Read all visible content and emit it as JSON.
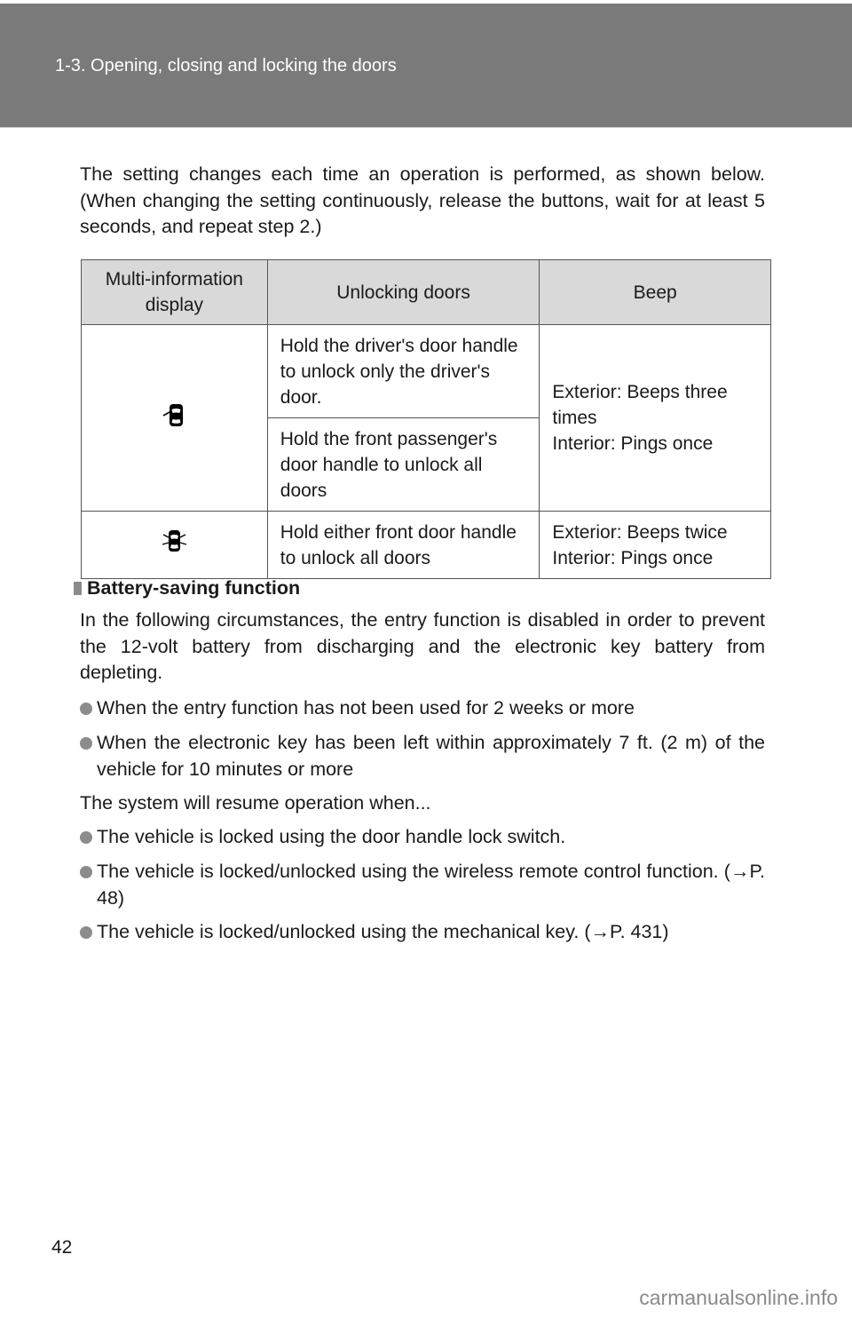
{
  "header": {
    "section_title": "1-3. Opening, closing and locking the doors"
  },
  "intro_text": "The setting changes each time an operation is performed, as shown below. (When changing the setting continuously, release the buttons, wait for at least 5 seconds, and repeat step 2.)",
  "table": {
    "headers": [
      "Multi-information display",
      "Unlocking doors",
      "Beep"
    ],
    "rows": [
      {
        "icon": "car-driver-door-open-icon",
        "unlocking": [
          "Hold the driver's door handle to unlock only the driver's door.",
          "Hold the front passenger's door handle to unlock all doors"
        ],
        "beep": [
          "Exterior: Beeps three times",
          "Interior: Pings once"
        ]
      },
      {
        "icon": "car-all-doors-open-icon",
        "unlocking": [
          "Hold either front door handle to unlock all doors"
        ],
        "beep": [
          "Exterior: Beeps twice",
          "Interior: Pings once"
        ]
      }
    ]
  },
  "battery_section": {
    "heading": "Battery-saving function",
    "description": "In the following circumstances, the entry function is disabled in order to prevent the 12-volt battery from discharging and the electronic key battery from depleting.",
    "conditions": [
      "When the entry function has not been used for 2 weeks or more",
      "When the electronic key has been left within approximately 7 ft. (2 m) of the vehicle for 10 minutes or more"
    ],
    "resume_intro": "The system will resume operation when...",
    "resume_items": [
      "The vehicle is locked using the door handle lock switch.",
      "The vehicle is locked/unlocked using the wireless remote control function. (→P. 48)",
      "The vehicle is locked/unlocked using the mechanical key. (→P. 431)"
    ]
  },
  "footer": {
    "page_number": "42",
    "watermark": "carmanualsonline.info"
  }
}
